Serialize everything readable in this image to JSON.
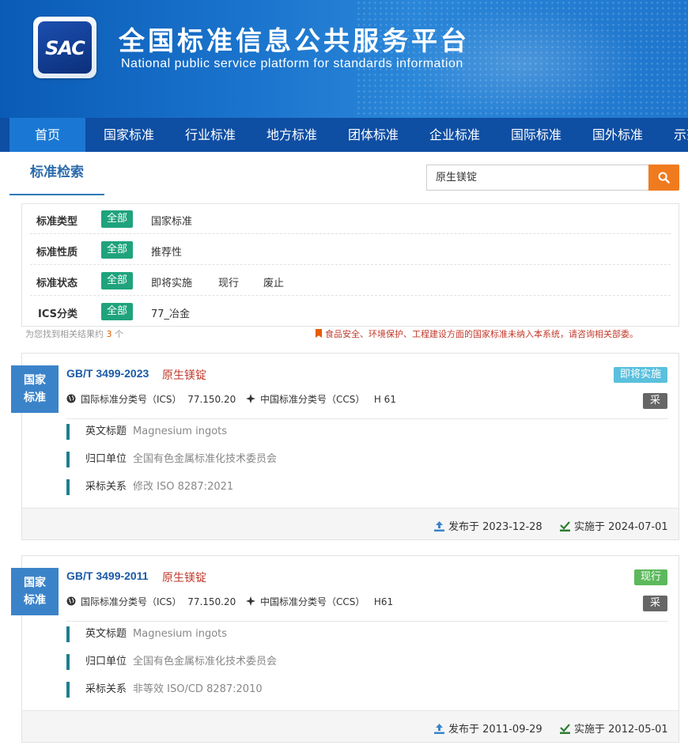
{
  "header": {
    "logo_text": "SAC",
    "title": "全国标准信息公共服务平台",
    "subtitle": "National public service platform  for standards information"
  },
  "nav": {
    "items": [
      "首页",
      "国家标准",
      "行业标准",
      "地方标准",
      "团体标准",
      "企业标准",
      "国际标准",
      "国外标准",
      "示范"
    ],
    "active": "首页"
  },
  "search": {
    "tab_label": "标准检索",
    "query": "原生镁锭"
  },
  "filters": [
    {
      "label": "标准类型",
      "all": "全部",
      "options": [
        "国家标准"
      ]
    },
    {
      "label": "标准性质",
      "all": "全部",
      "options": [
        "推荐性"
      ]
    },
    {
      "label": "标准状态",
      "all": "全部",
      "options": [
        "即将实施",
        "现行",
        "废止"
      ]
    },
    {
      "label": "ICS分类",
      "all": "全部",
      "options": [
        "77_冶金"
      ]
    }
  ],
  "results_summary": {
    "prefix": "为您找到相关结果约",
    "count": "3",
    "suffix": "个",
    "notice": "食品安全、环境保护、工程建设方面的国家标准未纳入本系统，请咨询相关部委。"
  },
  "results": [
    {
      "type_badge_line1": "国家",
      "type_badge_line2": "标准",
      "code": "GB/T 3499-2023",
      "name": "原生镁锭",
      "ics_label": "国际标准分类号（ICS）",
      "ics_value": "77.150.20",
      "ccs_label": "中国标准分类号（CCS）",
      "ccs_value": "H 61",
      "status": "即将实施",
      "status_color": "#5bc0de",
      "adopt_tag": "采",
      "en_title_label": "英文标题",
      "en_title": "Magnesium ingots",
      "dept_label": "归口单位",
      "dept": "全国有色金属标准化技术委员会",
      "relation_label": "采标关系",
      "relation": "修改  ISO 8287:2021",
      "publish_label": "发布于",
      "publish_date": "2023-12-28",
      "implement_label": "实施于",
      "implement_date": "2024-07-01"
    },
    {
      "type_badge_line1": "国家",
      "type_badge_line2": "标准",
      "code": "GB/T 3499-2011",
      "name": "原生镁锭",
      "ics_label": "国际标准分类号（ICS）",
      "ics_value": "77.150.20",
      "ccs_label": "中国标准分类号（CCS）",
      "ccs_value": "H61",
      "status": "现行",
      "status_color": "#5cb85c",
      "adopt_tag": "采",
      "en_title_label": "英文标题",
      "en_title": "Magnesium ingots",
      "dept_label": "归口单位",
      "dept": "全国有色金属标准化技术委员会",
      "relation_label": "采标关系",
      "relation": "非等效  ISO/CD 8287:2010",
      "publish_label": "发布于",
      "publish_date": "2011-09-29",
      "implement_label": "实施于",
      "implement_date": "2012-05-01"
    }
  ]
}
